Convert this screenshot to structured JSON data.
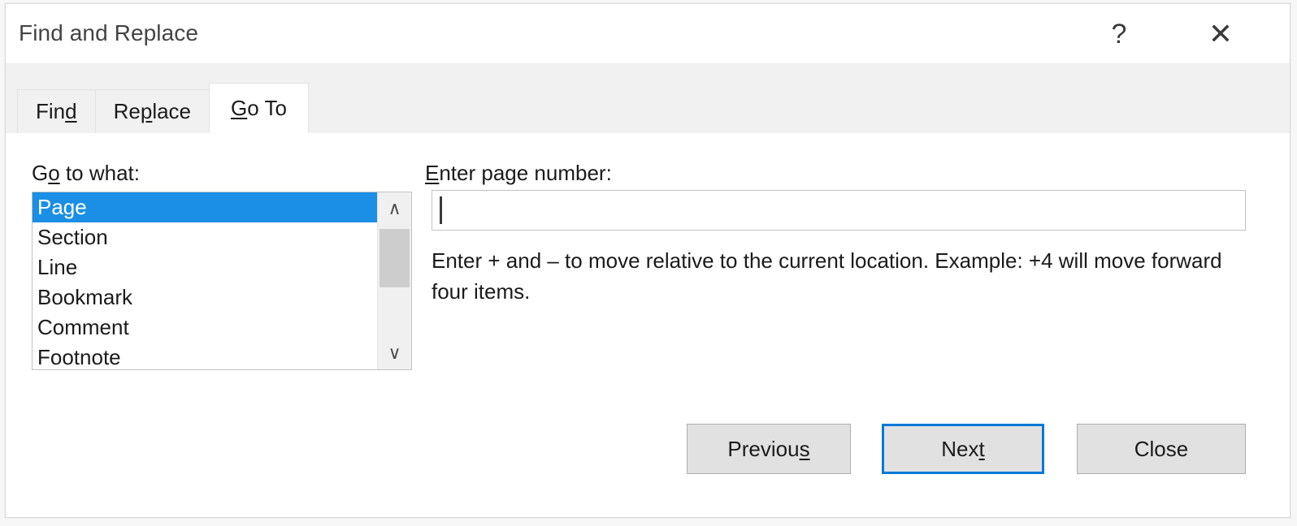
{
  "dialog": {
    "title": "Find and Replace",
    "titlebar_buttons": [
      {
        "name": "help",
        "glyph": "?"
      },
      {
        "name": "close",
        "glyph": "✕"
      }
    ]
  },
  "tabs": [
    {
      "label": "Find",
      "accel_prefix": "Fin",
      "accel_char": "d",
      "accel_suffix": "",
      "active": false
    },
    {
      "label": "Replace",
      "accel_prefix": "Re",
      "accel_char": "p",
      "accel_suffix": "lace",
      "active": false
    },
    {
      "label": "Go To",
      "accel_prefix": "",
      "accel_char": "G",
      "accel_suffix": "o To",
      "active": true
    }
  ],
  "goto_panel": {
    "list_label": {
      "prefix": "G",
      "accel_char": "o",
      "suffix": " to what:"
    },
    "list_items": [
      {
        "label": "Page",
        "selected": true
      },
      {
        "label": "Section",
        "selected": false
      },
      {
        "label": "Line",
        "selected": false
      },
      {
        "label": "Bookmark",
        "selected": false
      },
      {
        "label": "Comment",
        "selected": false
      },
      {
        "label": "Footnote",
        "selected": false
      }
    ],
    "scrollbar": {
      "up_arrow_glyph": "∧",
      "down_arrow_glyph": "∨"
    },
    "input_label": {
      "prefix": "",
      "accel_char": "E",
      "suffix": "nter page number:"
    },
    "input": {
      "value": "",
      "placeholder": ""
    },
    "hint": "Enter + and – to move relative to the current location. Example: +4 will move forward four items."
  },
  "buttons": [
    {
      "name": "previous",
      "prefix": "Previou",
      "accel_char": "s",
      "suffix": "",
      "default": false
    },
    {
      "name": "next",
      "prefix": "Nex",
      "accel_char": "t",
      "suffix": "",
      "default": true
    },
    {
      "name": "close",
      "prefix": "Close",
      "accel_char": "",
      "suffix": "",
      "default": false
    }
  ],
  "colors": {
    "accent_selection": "#1a8fe5",
    "default_button_border": "#0078d7",
    "dialog_background": "#ffffff",
    "tabstrip_background": "#f1f1f1",
    "button_face": "#e1e1e1",
    "scrollbar_thumb": "#cdcdcd"
  }
}
